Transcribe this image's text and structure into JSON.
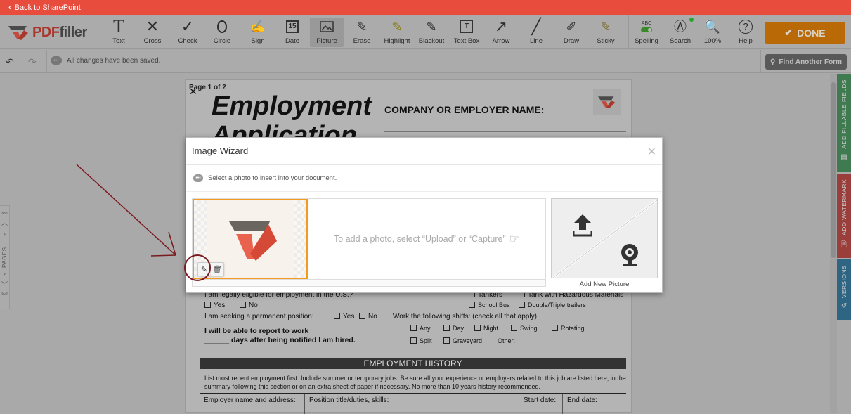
{
  "topbar": {
    "back_label": "Back to SharePoint",
    "back_icon": "chevron-left-icon"
  },
  "logo": {
    "pdf": "PDF",
    "filler": "filler"
  },
  "toolbar": {
    "tools": [
      {
        "id": "text",
        "label": "Text",
        "icon": "T"
      },
      {
        "id": "cross",
        "label": "Cross",
        "icon": "✕"
      },
      {
        "id": "check",
        "label": "Check",
        "icon": "✓"
      },
      {
        "id": "circle",
        "label": "Circle",
        "icon": "○"
      },
      {
        "id": "sign",
        "label": "Sign",
        "icon": "✍"
      },
      {
        "id": "date",
        "label": "Date",
        "icon": "15"
      },
      {
        "id": "picture",
        "label": "Picture",
        "icon": "🖼",
        "active": true
      },
      {
        "id": "erase",
        "label": "Erase",
        "icon": "✎"
      },
      {
        "id": "highlight",
        "label": "Highlight",
        "icon": "✎"
      },
      {
        "id": "blackout",
        "label": "Blackout",
        "icon": "✎"
      },
      {
        "id": "textbox",
        "label": "Text Box",
        "icon": "T"
      },
      {
        "id": "arrow",
        "label": "Arrow",
        "icon": "↗"
      },
      {
        "id": "line",
        "label": "Line",
        "icon": "╱"
      },
      {
        "id": "draw",
        "label": "Draw",
        "icon": "✐"
      },
      {
        "id": "sticky",
        "label": "Sticky",
        "icon": "✎"
      }
    ],
    "right_tools": [
      {
        "id": "spelling",
        "label": "Spelling",
        "top": "ABC"
      },
      {
        "id": "search",
        "label": "Search"
      },
      {
        "id": "zoom",
        "label": "100%"
      },
      {
        "id": "help",
        "label": "Help",
        "icon": "?"
      }
    ],
    "done_label": "DONE"
  },
  "subbar": {
    "saved_text": "All changes have been saved.",
    "find_form_label": "Find Another Form"
  },
  "document": {
    "page_indicator": "Page 1 of 2",
    "title_line1": "Employment",
    "title_line2": "Application",
    "company_label": "COMPANY OR EMPLOYER NAME:",
    "eligible": "I am legally eligible for employment in the U.S.?",
    "yes": "Yes",
    "no": "No",
    "permanent": "I am seeking a permanent position:",
    "report1": "I will be able to report to work",
    "report2": "______ days after being notified I am hired.",
    "tankers": "Tankers",
    "tank_haz": "Tank with Hazardous Materials",
    "school_bus": "School Bus",
    "double_triple": "Double/Triple trailers",
    "shifts_label": "Work the following shifts: (check all that apply)",
    "shifts": [
      "Any",
      "Day",
      "Night",
      "Swing",
      "Rotating"
    ],
    "shifts2": [
      "Split",
      "Graveyard"
    ],
    "other": "Other:",
    "history_title": "EMPLOYMENT HISTORY",
    "history_text": "List most recent employment first. Include summer or temporary jobs. Be sure all your experience or employers related to this job are listed here, in the summary following this section or on an extra sheet of paper if necessary. No more than 10 years history recommended.",
    "history_cols": [
      "Employer name and address:",
      "Position title/duties, skills:",
      "Start date:",
      "End date:"
    ]
  },
  "pages_panel": {
    "label": "PAGES"
  },
  "side_tabs": [
    {
      "label": "ADD FILLABLE FIELDS",
      "color": "#3f8a57"
    },
    {
      "label": "ADD WATERMARK",
      "color": "#a8403d"
    },
    {
      "label": "VERSIONS",
      "color": "#2f6f8e"
    }
  ],
  "modal": {
    "title": "Image Wizard",
    "info": "Select a photo to insert into your document.",
    "hint": "To add a photo, select “Upload” or “Capture”",
    "add_new": "Add New Picture"
  }
}
